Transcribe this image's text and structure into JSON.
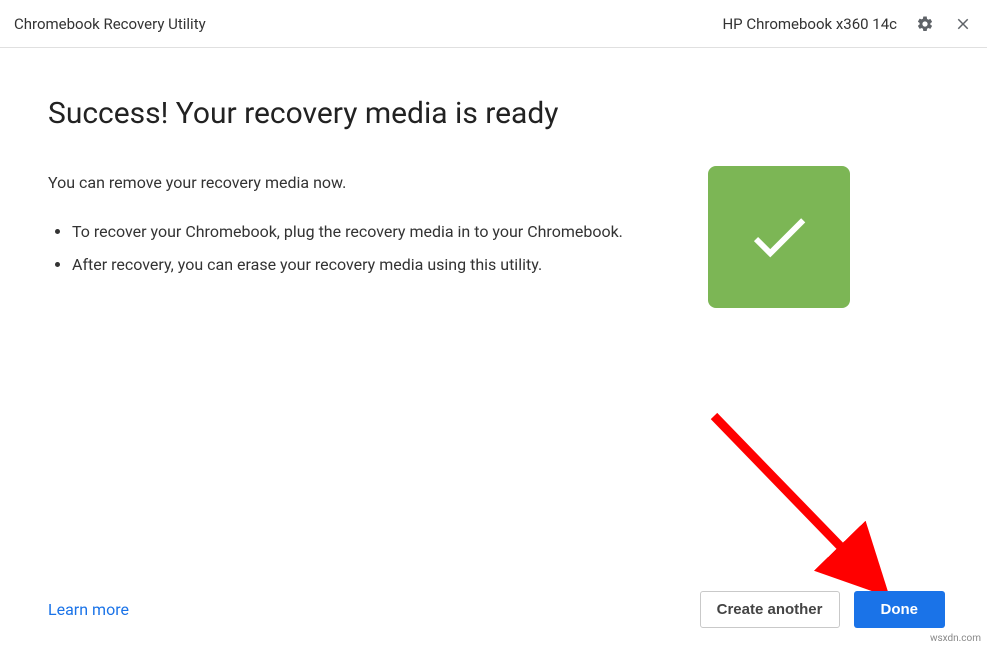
{
  "header": {
    "app_title": "Chromebook Recovery Utility",
    "device_name": "HP Chromebook x360 14c"
  },
  "main": {
    "heading": "Success! Your recovery media is ready",
    "intro": "You can remove your recovery media now.",
    "bullets": [
      "To recover your Chromebook, plug the recovery media in to your Chromebook.",
      "After recovery, you can erase your recovery media using this utility."
    ]
  },
  "footer": {
    "learn_more": "Learn more",
    "create_another": "Create another",
    "done": "Done"
  },
  "colors": {
    "primary": "#1a73e8",
    "success": "#7cb655"
  },
  "watermark": "wsxdn.com"
}
